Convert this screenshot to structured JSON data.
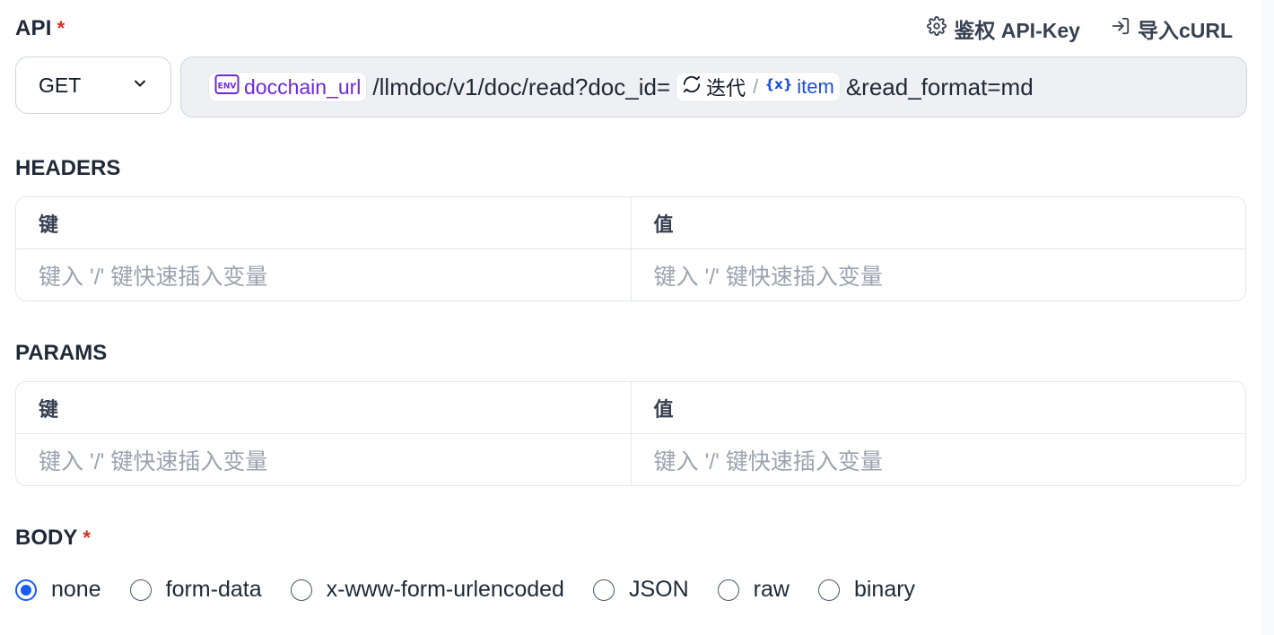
{
  "api": {
    "label": "API",
    "required_mark": "*",
    "auth_label": "鉴权 API-Key",
    "import_label": "导入cURL",
    "method": "GET",
    "url": {
      "env_chip": "docchain_url",
      "path": "/llmdoc/v1/doc/read?doc_id=",
      "iter_label": "迭代",
      "sep": "/",
      "var_label": "item",
      "suffix": "&read_format=md"
    }
  },
  "headers": {
    "label": "HEADERS",
    "col_key": "键",
    "col_value": "值",
    "key_placeholder": "键入 '/' 键快速插入变量",
    "value_placeholder": "键入 '/' 键快速插入变量"
  },
  "params": {
    "label": "PARAMS",
    "col_key": "键",
    "col_value": "值",
    "key_placeholder": "键入 '/' 键快速插入变量",
    "value_placeholder": "键入 '/' 键快速插入变量"
  },
  "body": {
    "label": "BODY",
    "required_mark": "*",
    "options": [
      "none",
      "form-data",
      "x-www-form-urlencoded",
      "JSON",
      "raw",
      "binary"
    ],
    "selected": "none"
  },
  "colors": {
    "accent": "#155eef",
    "env": "#6d28d9",
    "var": "#1d4ed8",
    "required": "#d92d20"
  }
}
